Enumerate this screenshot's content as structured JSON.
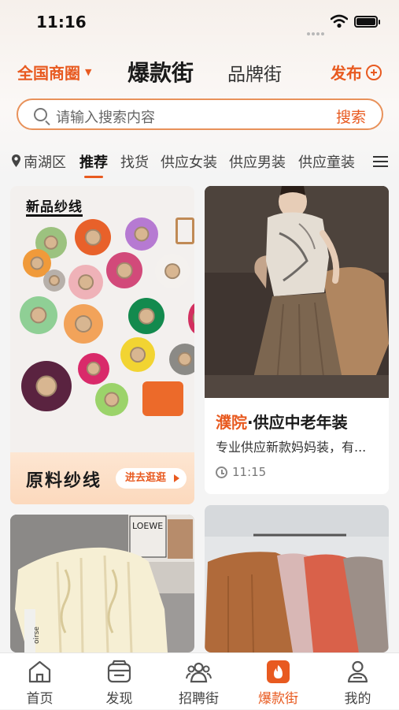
{
  "status_bar": {
    "time": "11:16"
  },
  "header": {
    "area_select": "全国商圈",
    "tabs": [
      {
        "label": "爆款街",
        "active": true
      },
      {
        "label": "品牌街",
        "active": false
      }
    ],
    "publish_label": "发布"
  },
  "search": {
    "placeholder": "请输入搜索内容",
    "button_label": "搜索"
  },
  "categories": {
    "location": "南湖区",
    "items": [
      {
        "label": "推荐",
        "active": true
      },
      {
        "label": "找货",
        "active": false
      },
      {
        "label": "供应女装",
        "active": false
      },
      {
        "label": "供应男装",
        "active": false
      },
      {
        "label": "供应童装",
        "active": false
      }
    ]
  },
  "feed": {
    "yarn_card": {
      "tag": "新品纱线",
      "banner": "原料纱线",
      "cta": "进去逛逛"
    },
    "post_card": {
      "title_highlight": "濮院",
      "title_rest": "·供应中老年装",
      "description": "专业供应新款妈妈装，有...",
      "time": "11:15"
    },
    "sweater_card": {
      "store_sign": "LOEWE",
      "tag_text": "oirse"
    }
  },
  "bottom_nav": [
    {
      "label": "首页",
      "icon": "home-icon",
      "active": false
    },
    {
      "label": "发现",
      "icon": "discover-icon",
      "active": false
    },
    {
      "label": "招聘街",
      "icon": "recruit-icon",
      "active": false
    },
    {
      "label": "爆款街",
      "icon": "fire-icon",
      "active": true
    },
    {
      "label": "我的",
      "icon": "profile-icon",
      "active": false
    }
  ],
  "colors": {
    "accent": "#e85a20",
    "search_border": "#e8915a",
    "background": "#f4f4f4"
  }
}
